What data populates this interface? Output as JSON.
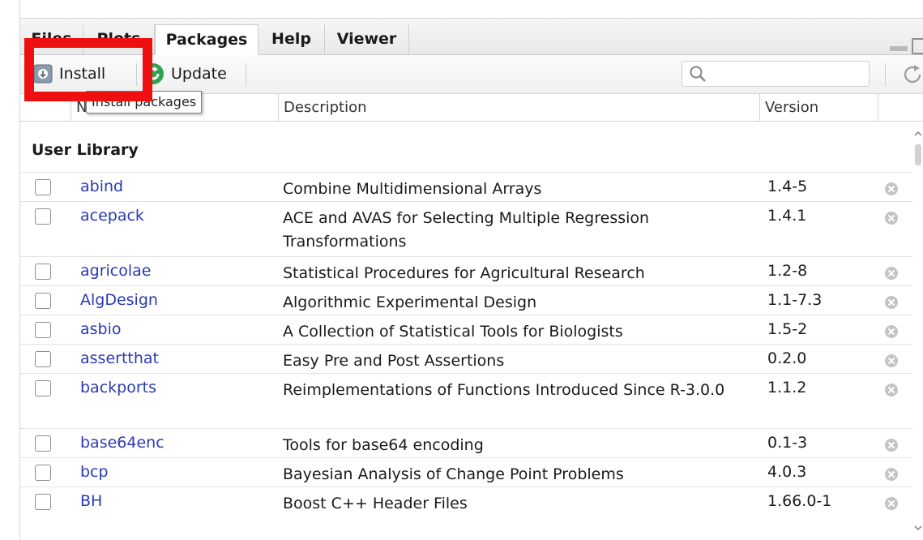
{
  "tabs": [
    {
      "label": "Files",
      "active": false
    },
    {
      "label": "Plots",
      "active": false
    },
    {
      "label": "Packages",
      "active": true
    },
    {
      "label": "Help",
      "active": false
    },
    {
      "label": "Viewer",
      "active": false
    }
  ],
  "toolbar": {
    "install_label": "Install",
    "update_label": "Update",
    "search_placeholder": "",
    "tooltip": "Install packages"
  },
  "columns": {
    "name": "Name",
    "description": "Description",
    "version": "Version"
  },
  "library": {
    "title": "User Library",
    "packages": [
      {
        "name": "abind",
        "description": "Combine Multidimensional Arrays",
        "version": "1.4-5"
      },
      {
        "name": "acepack",
        "description": "ACE and AVAS for Selecting Multiple Regression Transformations",
        "version": "1.4.1"
      },
      {
        "name": "agricolae",
        "description": "Statistical Procedures for Agricultural Research",
        "version": "1.2-8"
      },
      {
        "name": "AlgDesign",
        "description": "Algorithmic Experimental Design",
        "version": "1.1-7.3"
      },
      {
        "name": "asbio",
        "description": "A Collection of Statistical Tools for Biologists",
        "version": "1.5-2"
      },
      {
        "name": "assertthat",
        "description": "Easy Pre and Post Assertions",
        "version": "0.2.0"
      },
      {
        "name": "backports",
        "description": "Reimplementations of Functions Introduced Since R-3.0.0",
        "version": "1.1.2"
      },
      {
        "name": "base64enc",
        "description": "Tools for base64 encoding",
        "version": "0.1-3"
      },
      {
        "name": "bcp",
        "description": "Bayesian Analysis of Change Point Problems",
        "version": "4.0.3"
      },
      {
        "name": "BH",
        "description": "Boost C++ Header Files",
        "version": "1.66.0-1"
      }
    ]
  },
  "colors": {
    "link": "#2a3ab5",
    "highlight": "#ee1010",
    "update_green": "#2ea44f"
  }
}
